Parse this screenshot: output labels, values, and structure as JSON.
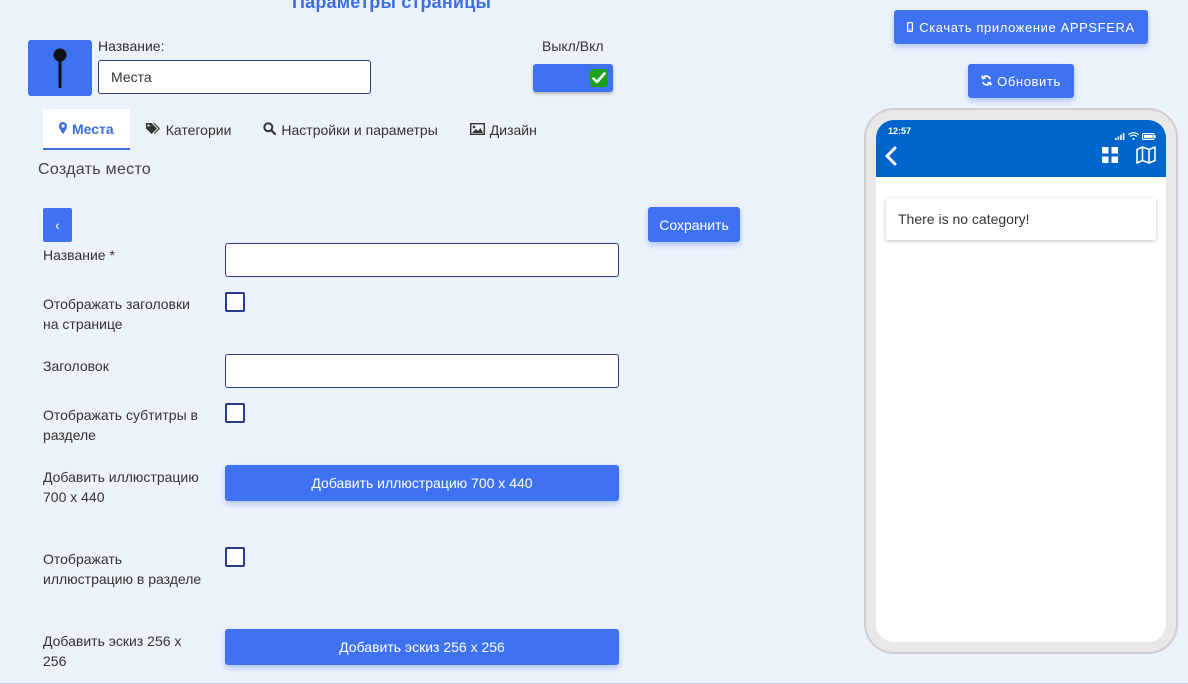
{
  "header": {
    "title": "Параметры страницы"
  },
  "page_settings": {
    "name_label": "Название:",
    "name_value": "Места",
    "toggle_label": "Выкл/Вкл",
    "toggle_on": true
  },
  "tabs": [
    {
      "label": "Места",
      "icon": "map-marker-icon",
      "active": true
    },
    {
      "label": "Категории",
      "icon": "tags-icon",
      "active": false
    },
    {
      "label": "Настройки и параметры",
      "icon": "search-icon",
      "active": false
    },
    {
      "label": "Дизайн",
      "icon": "image-icon",
      "active": false
    }
  ],
  "form": {
    "section_title": "Создать место",
    "back_label": "‹",
    "save_label": "Сохранить",
    "name_label": "Название *",
    "show_headings_label": "Отображать заголовки на странице",
    "heading_label": "Заголовок",
    "show_subtitles_label": "Отображать субтитры в разделе",
    "add_illustration_label": "Добавить иллюстрацию 700 x 440",
    "add_illustration_button": "Добавить иллюстрацию 700 x 440",
    "show_illustration_label": "Отображать иллюстрацию в разделе",
    "add_thumbnail_label": "Добавить эскиз 256 x 256",
    "add_thumbnail_button": "Добавить эскиз 256 x 256"
  },
  "sidebar": {
    "download_label": "Скачать приложение APPSFERA",
    "refresh_label": "Обновить"
  },
  "phone": {
    "time": "12:57",
    "empty_message": "There is no category!"
  },
  "colors": {
    "accent": "#3f72f0",
    "background": "#ecf2fb",
    "phone_header": "#0066cc",
    "toggle_check": "#1da11d"
  }
}
